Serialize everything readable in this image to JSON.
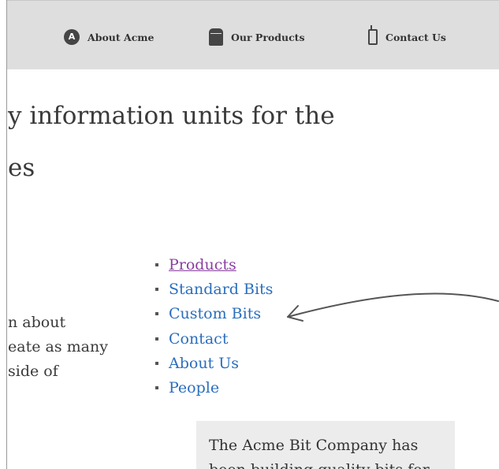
{
  "nav": {
    "items": [
      {
        "label": "About Acme",
        "icon": "circle-a-icon"
      },
      {
        "label": "Our Products",
        "icon": "box-icon"
      },
      {
        "label": "Contact Us",
        "icon": "phone-icon"
      }
    ]
  },
  "headline": {
    "line1": "y information units for the",
    "line2": "es"
  },
  "body_text": {
    "line1": "n about",
    "line2": "eate as many",
    "line3": "side of"
  },
  "menu": {
    "items": [
      {
        "label": "Products",
        "visited": true
      },
      {
        "label": "Standard Bits"
      },
      {
        "label": "Custom Bits"
      },
      {
        "label": "Contact"
      },
      {
        "label": "About Us"
      },
      {
        "label": "People"
      }
    ]
  },
  "sidebox": {
    "line1": "The Acme Bit Company has",
    "line2": "been building quality bits for"
  },
  "colors": {
    "link": "#2a6ebd",
    "visited_link": "#8a3fa0",
    "nav_bg": "#dedede",
    "sidebox_bg": "#ececec"
  }
}
